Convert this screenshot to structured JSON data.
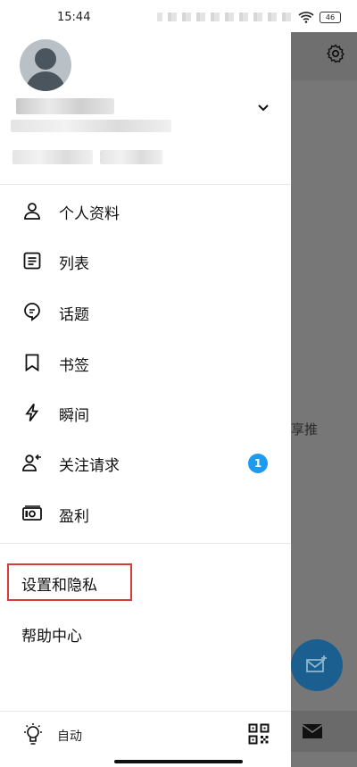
{
  "status_bar": {
    "time": "15:44",
    "battery": "46"
  },
  "drawer": {
    "menu": [
      {
        "label": "个人资料",
        "icon": "person-icon"
      },
      {
        "label": "列表",
        "icon": "list-icon"
      },
      {
        "label": "话题",
        "icon": "topic-icon"
      },
      {
        "label": "书签",
        "icon": "bookmark-icon"
      },
      {
        "label": "瞬间",
        "icon": "lightning-icon"
      },
      {
        "label": "关注请求",
        "icon": "follow-request-icon",
        "badge": "1"
      },
      {
        "label": "盈利",
        "icon": "money-icon"
      }
    ],
    "settings_label": "设置和隐私",
    "help_label": "帮助中心",
    "footer": {
      "theme_label": "自动"
    }
  },
  "background": {
    "partial_text": "享推"
  },
  "colors": {
    "accent": "#1d9bf0",
    "highlight_border": "#d93b3b"
  }
}
